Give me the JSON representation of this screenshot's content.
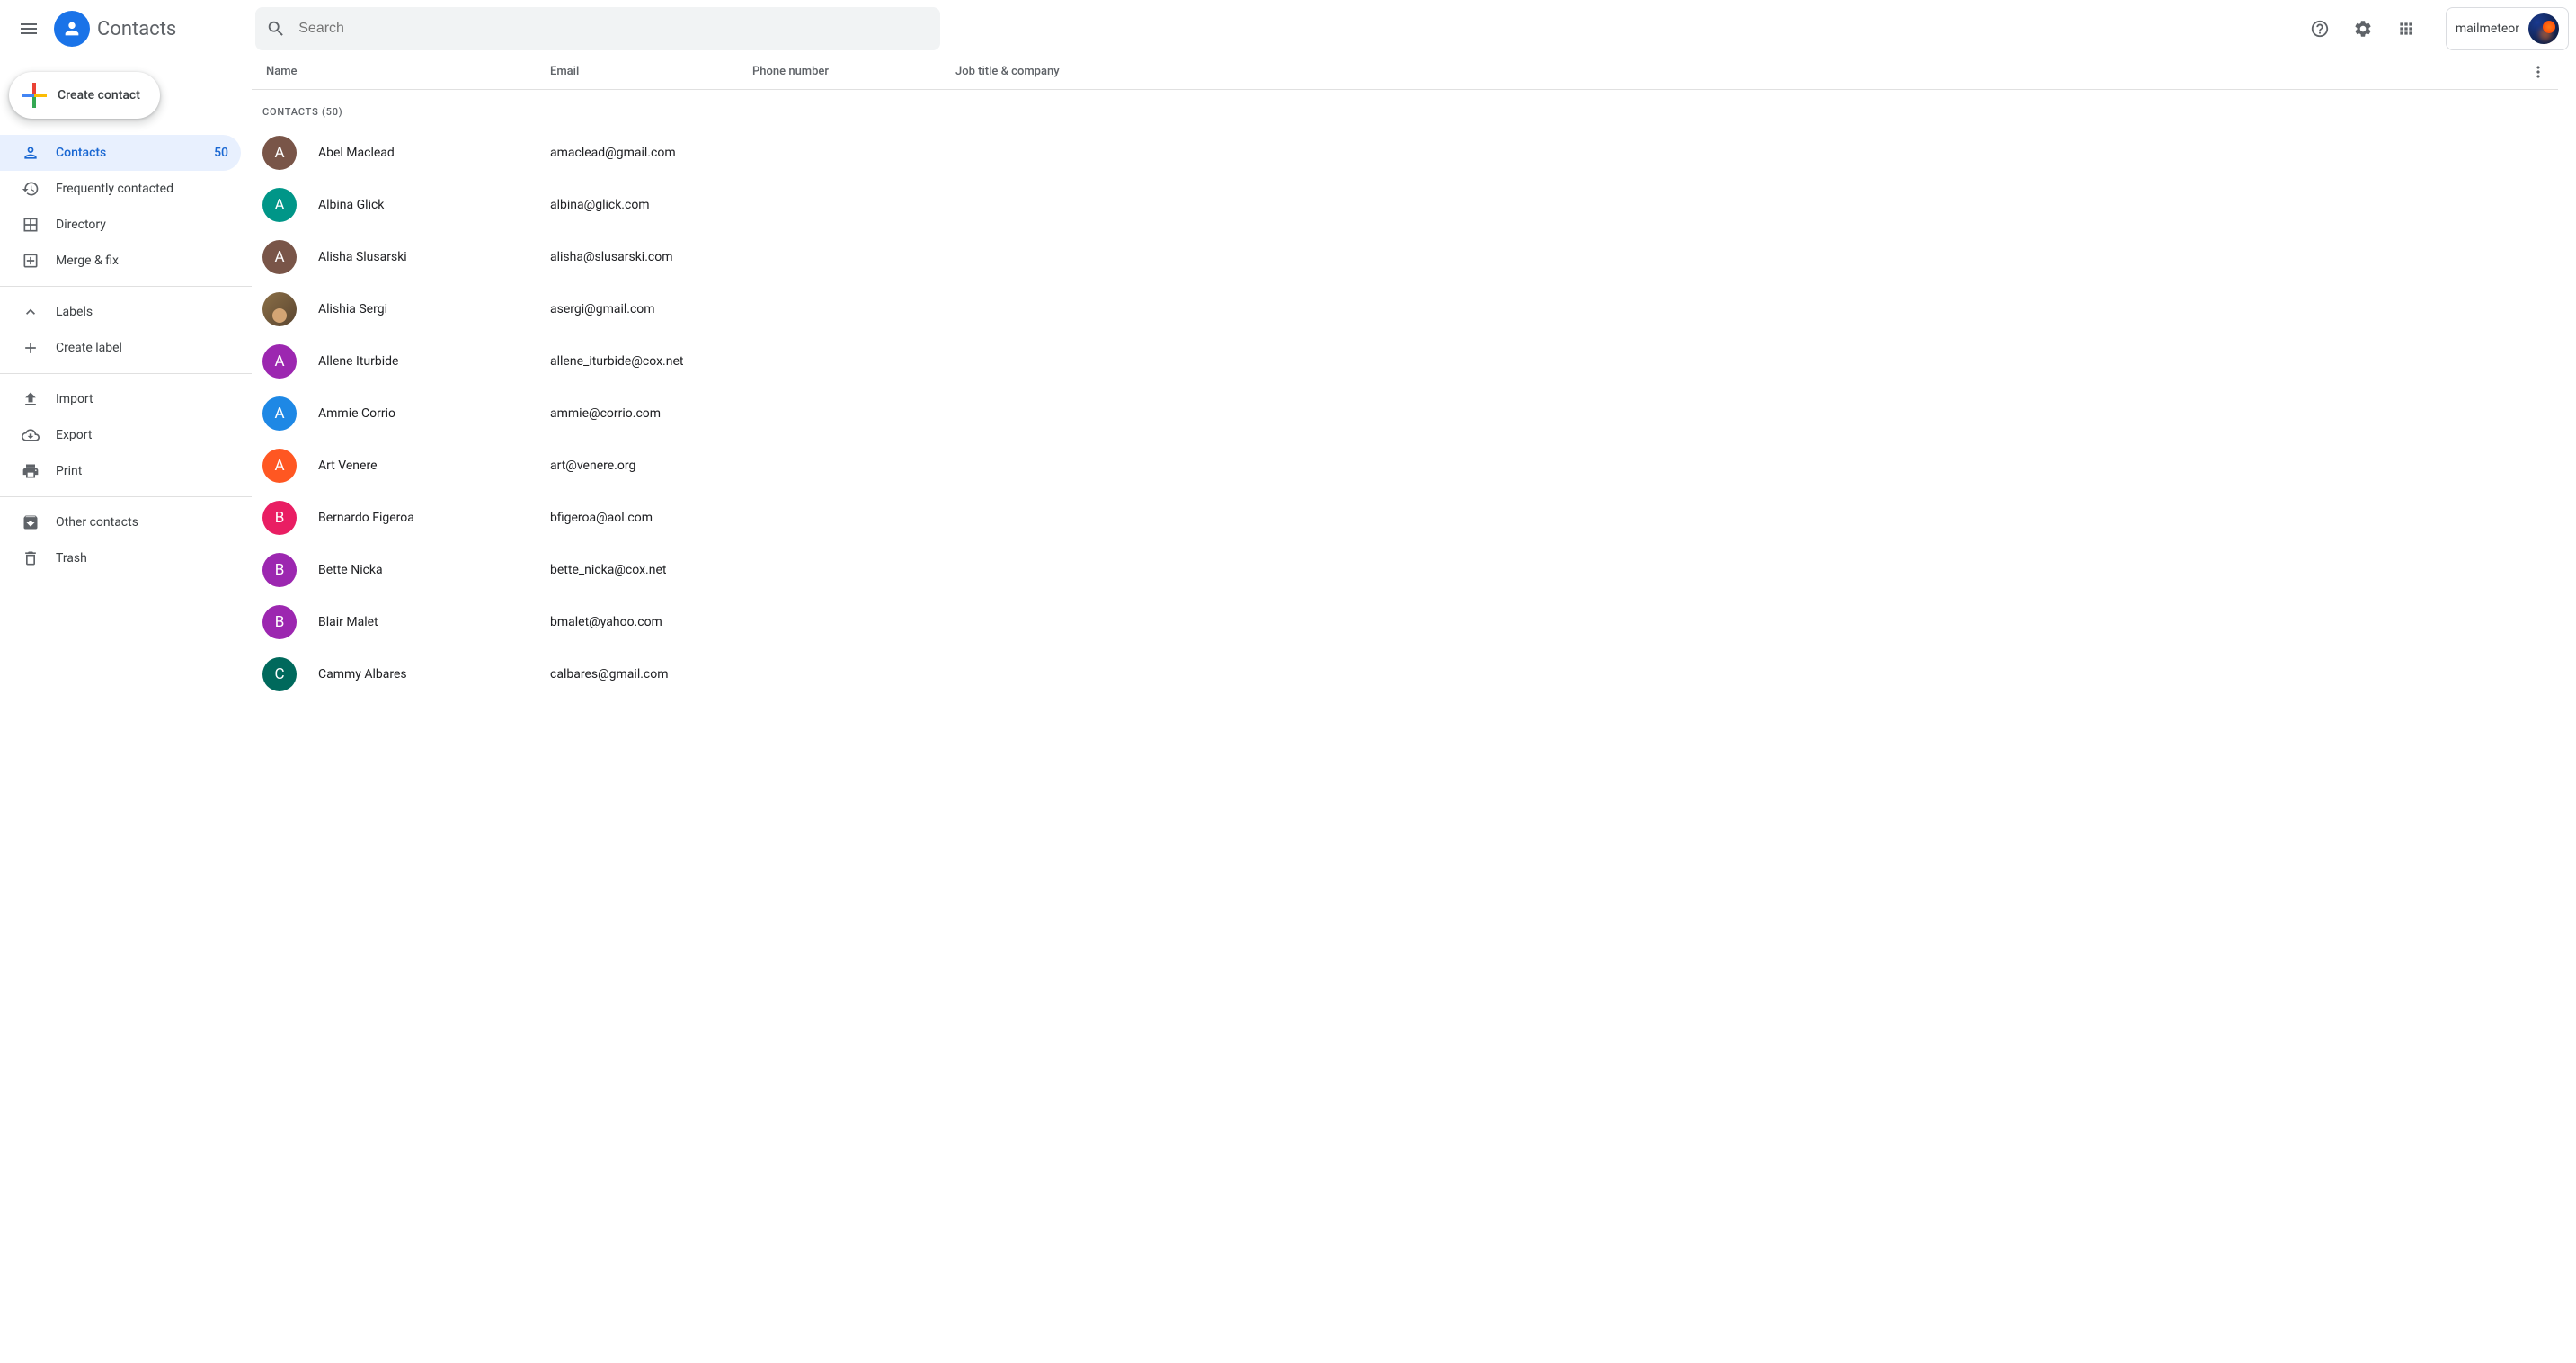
{
  "app": {
    "title": "Contacts"
  },
  "search": {
    "placeholder": "Search"
  },
  "extension": {
    "label": "mailmeteor"
  },
  "create_button": "Create contact",
  "sidebar": {
    "contacts": {
      "label": "Contacts",
      "count": "50"
    },
    "frequent": "Frequently contacted",
    "directory": "Directory",
    "merge_fix": "Merge & fix",
    "labels_header": "Labels",
    "create_label": "Create label",
    "import": "Import",
    "export": "Export",
    "print": "Print",
    "other": "Other contacts",
    "trash": "Trash"
  },
  "columns": {
    "name": "Name",
    "email": "Email",
    "phone": "Phone number",
    "job": "Job title & company"
  },
  "group_label": "CONTACTS (50)",
  "contacts": [
    {
      "initial": "A",
      "color": "#795548",
      "name": "Abel Maclead",
      "email": "amaclead@gmail.com"
    },
    {
      "initial": "A",
      "color": "#009688",
      "name": "Albina Glick",
      "email": "albina@glick.com"
    },
    {
      "initial": "A",
      "color": "#795548",
      "name": "Alisha Slusarski",
      "email": "alisha@slusarski.com"
    },
    {
      "initial": "",
      "color": "photo",
      "name": "Alishia Sergi",
      "email": "asergi@gmail.com"
    },
    {
      "initial": "A",
      "color": "#9c27b0",
      "name": "Allene Iturbide",
      "email": "allene_iturbide@cox.net"
    },
    {
      "initial": "A",
      "color": "#1e88e5",
      "name": "Ammie Corrio",
      "email": "ammie@corrio.com"
    },
    {
      "initial": "A",
      "color": "#ff5722",
      "name": "Art Venere",
      "email": "art@venere.org"
    },
    {
      "initial": "B",
      "color": "#e91e63",
      "name": "Bernardo Figeroa",
      "email": "bfigeroa@aol.com"
    },
    {
      "initial": "B",
      "color": "#9c27b0",
      "name": "Bette Nicka",
      "email": "bette_nicka@cox.net"
    },
    {
      "initial": "B",
      "color": "#9c27b0",
      "name": "Blair Malet",
      "email": "bmalet@yahoo.com"
    },
    {
      "initial": "C",
      "color": "#00695c",
      "name": "Cammy Albares",
      "email": "calbares@gmail.com"
    }
  ]
}
